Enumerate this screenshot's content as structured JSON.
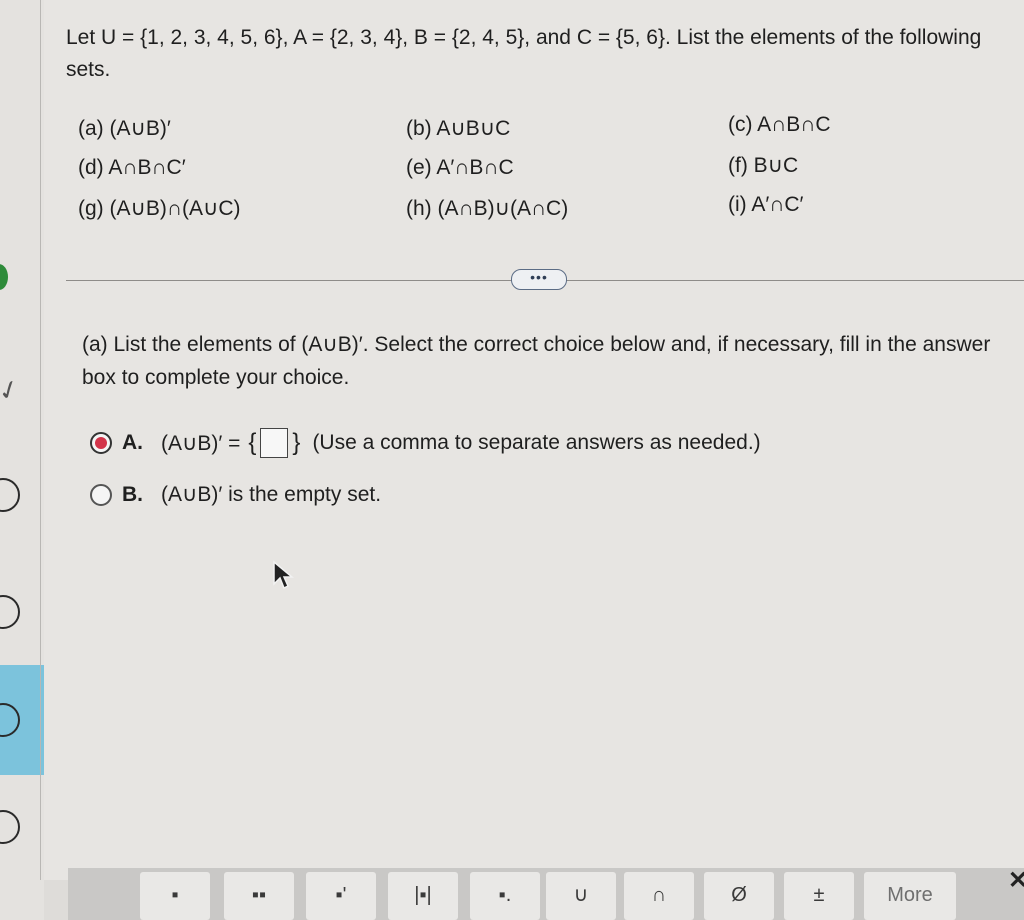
{
  "question": {
    "prompt": "Let U = {1, 2, 3, 4, 5, 6}, A = {2, 3, 4}, B = {2, 4, 5}, and C = {5, 6}. List the elements of the following sets.",
    "parts": [
      {
        "label": "(a) (A∪B)′"
      },
      {
        "label": "(b) A∪B∪C"
      },
      {
        "label": "(c) A∩B∩C"
      },
      {
        "label": "(d) A∩B∩C′"
      },
      {
        "label": "(e) A′∩B∩C"
      },
      {
        "label": "(f) B∪C"
      },
      {
        "label": "(g) (A∪B)∩(A∪C)"
      },
      {
        "label": "(h) (A∩B)∪(A∩C)"
      },
      {
        "label": "(i) A′∩C′"
      }
    ]
  },
  "expand_button": "•••",
  "subquestion": "(a) List the elements of (A∪B)′. Select the correct choice below and, if necessary, fill in the answer box to complete your choice.",
  "choices": {
    "a": {
      "letter": "A.",
      "text_before": "(A∪B)′ =",
      "brace_open": "{",
      "brace_close": "}",
      "hint": "(Use a comma to separate answers as needed.)",
      "selected": true
    },
    "b": {
      "letter": "B.",
      "text": "(A∪B)′ is the empty set.",
      "selected": false
    }
  },
  "toolbar": {
    "buttons": [
      "▪",
      "▪▪",
      "▪'",
      "|▪|",
      "▪.",
      "∪",
      "∩",
      "Ø",
      "±"
    ],
    "more_label": "More"
  },
  "colors": {
    "accent_radio": "#d3344a",
    "rail_selected": "#7cc3dc",
    "rail_complete": "#2e8b3a"
  }
}
